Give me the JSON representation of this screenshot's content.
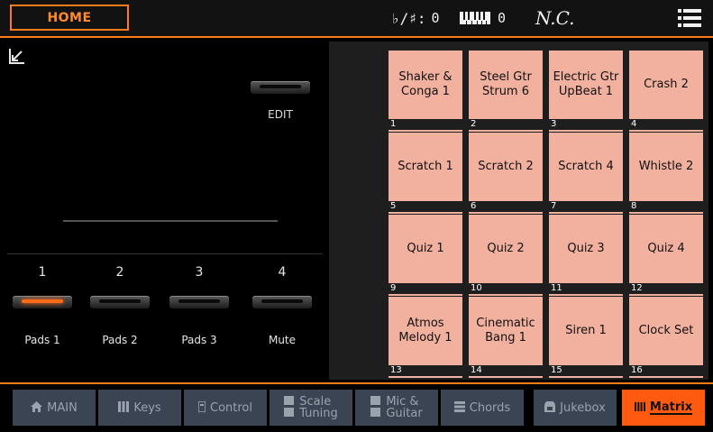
{
  "topbar": {
    "home_label": "HOME",
    "accidental_label": "♭/♯:",
    "accidental_value": "0",
    "transpose_value": "0",
    "chord": "N.C.",
    "menu_icon": "hamburger-menu-icon"
  },
  "left": {
    "edit_label": "EDIT",
    "pads": [
      {
        "number": "1",
        "label": "Pads 1",
        "active": true
      },
      {
        "number": "2",
        "label": "Pads 2",
        "active": false
      },
      {
        "number": "3",
        "label": "Pads 3",
        "active": false
      },
      {
        "number": "4",
        "label": "Mute",
        "active": false
      }
    ]
  },
  "grid": {
    "pads": [
      {
        "index": "1",
        "name": "Shaker & Conga 1"
      },
      {
        "index": "2",
        "name": "Steel Gtr Strum 6"
      },
      {
        "index": "3",
        "name": "Electric Gtr UpBeat 1"
      },
      {
        "index": "4",
        "name": "Crash 2"
      },
      {
        "index": "5",
        "name": "Scratch 1"
      },
      {
        "index": "6",
        "name": "Scratch 2"
      },
      {
        "index": "7",
        "name": "Scratch 4"
      },
      {
        "index": "8",
        "name": "Whistle 2"
      },
      {
        "index": "9",
        "name": "Quiz 1"
      },
      {
        "index": "10",
        "name": "Quiz 2"
      },
      {
        "index": "11",
        "name": "Quiz 3"
      },
      {
        "index": "12",
        "name": "Quiz 4"
      },
      {
        "index": "13",
        "name": "Atmos Melody 1"
      },
      {
        "index": "14",
        "name": "Cinematic Bang 1"
      },
      {
        "index": "15",
        "name": "Siren 1"
      },
      {
        "index": "16",
        "name": "Clock Set"
      }
    ]
  },
  "tabs": [
    {
      "label": "MAIN",
      "line2": "",
      "icon": "home-icon"
    },
    {
      "label": "Keys",
      "line2": "",
      "icon": "keyboard-icon"
    },
    {
      "label": "Control",
      "line2": "",
      "icon": "control-icon"
    },
    {
      "label": "Scale",
      "line2": "Tuning",
      "icon": "scale-icon"
    },
    {
      "label": "Mic &",
      "line2": "Guitar",
      "icon": "mic-icon"
    },
    {
      "label": "Chords",
      "line2": "",
      "icon": "chords-icon"
    },
    {
      "label": "Jukebox",
      "line2": "",
      "icon": "jukebox-icon"
    },
    {
      "label": "Matrix",
      "line2": "",
      "icon": "matrix-icon",
      "active": true
    }
  ],
  "colors": {
    "accent": "#ff7a1a",
    "pad": "#f2b09e",
    "tab": "#3a4452",
    "tab_active": "#ff5a10"
  }
}
